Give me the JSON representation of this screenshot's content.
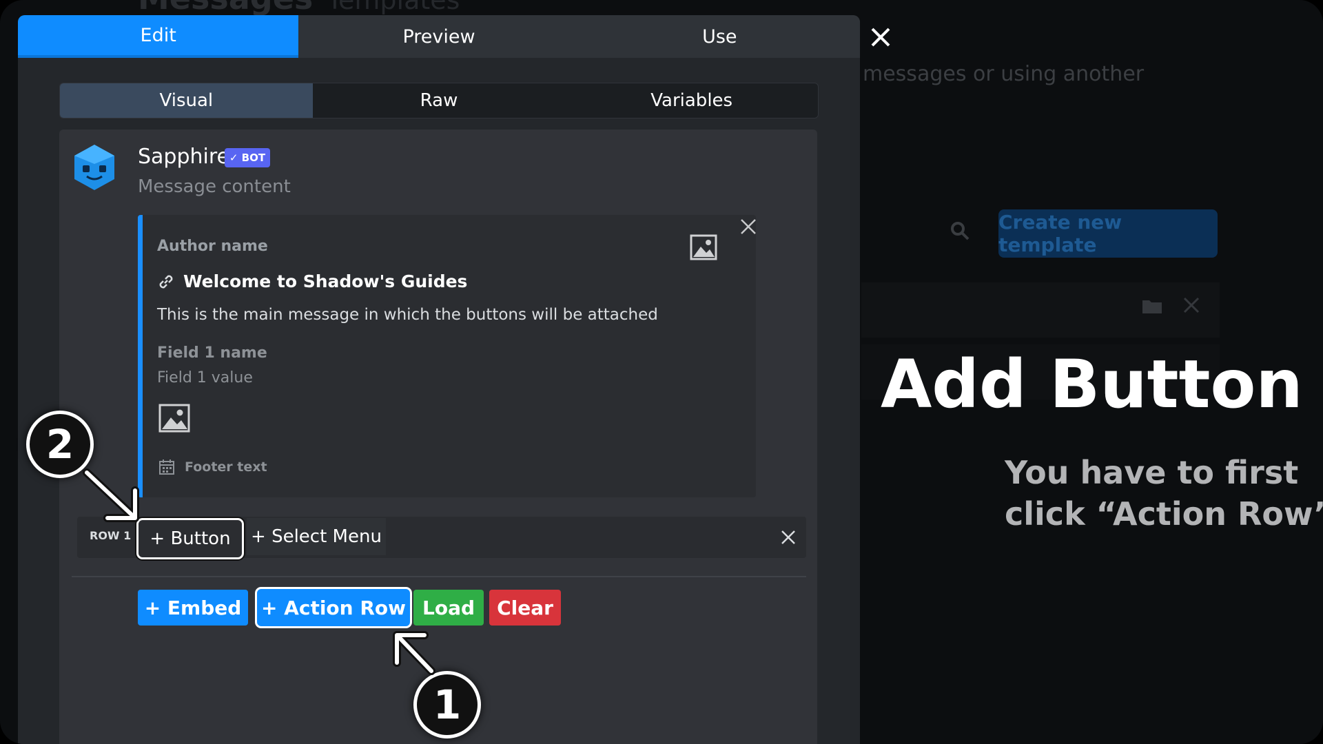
{
  "background": {
    "page_title": "Messages",
    "breadcrumb": "Templates",
    "subtitle": "messages or using another",
    "create_button": "Create new template"
  },
  "tabs": [
    {
      "label": "Edit",
      "active": true
    },
    {
      "label": "Preview",
      "active": false
    },
    {
      "label": "Use",
      "active": false
    }
  ],
  "subtabs": [
    {
      "label": "Visual",
      "active": true
    },
    {
      "label": "Raw",
      "active": false
    },
    {
      "label": "Variables",
      "active": false
    }
  ],
  "message": {
    "bot_name": "Sapphire",
    "bot_badge": "✓ BOT",
    "content_placeholder": "Message content"
  },
  "embed": {
    "author": "Author name",
    "title": "Welcome to Shadow's Guides",
    "description": "This is the main message in which the buttons will be attached",
    "field_name": "Field 1 name",
    "field_value": "Field 1 value",
    "footer": "Footer text",
    "accent_color": "#1a8fff"
  },
  "action_row": {
    "label": "ROW 1",
    "button_label": "+ Button",
    "select_menu_label": "+ Select Menu"
  },
  "toolbar": {
    "embed": "+ Embed",
    "action_row": "+ Action Row",
    "load": "Load",
    "clear": "Clear"
  },
  "overlay": {
    "title": "Add Button",
    "desc_line1": "You have to first",
    "desc_line2": "click “Action Row”",
    "marker_1": "1",
    "marker_2": "2"
  },
  "icons": [
    "close-icon",
    "search-icon",
    "folder-icon",
    "image-icon",
    "link-icon",
    "calendar-icon",
    "avatar"
  ]
}
